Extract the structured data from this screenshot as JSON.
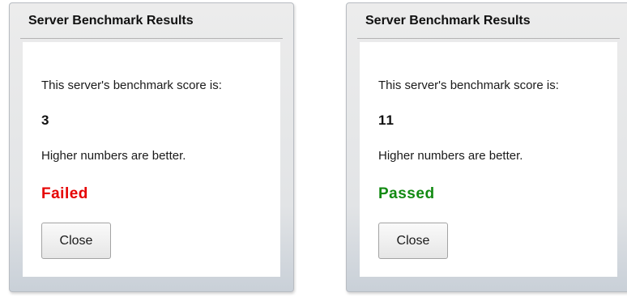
{
  "dialogs": [
    {
      "title": "Server Benchmark Results",
      "intro": "This server's benchmark score is:",
      "score": "3",
      "hint": "Higher numbers are better.",
      "status": "Failed",
      "status_color": "#e60000",
      "close_label": "Close"
    },
    {
      "title": "Server Benchmark Results",
      "intro": "This server's benchmark score is:",
      "score": "11",
      "hint": "Higher numbers are better.",
      "status": "Passed",
      "status_color": "#128a12",
      "close_label": "Close"
    }
  ]
}
